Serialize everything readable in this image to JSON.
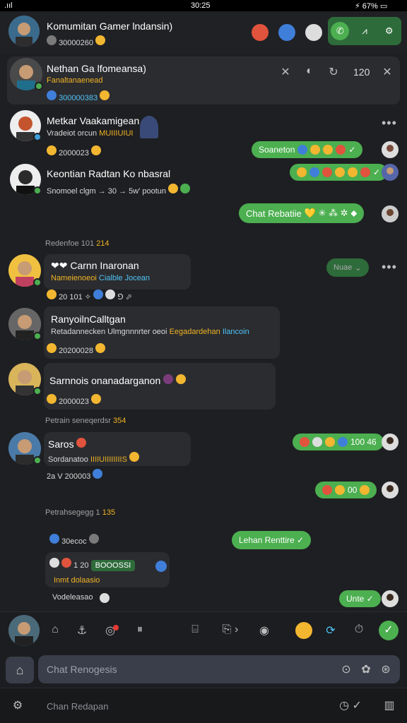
{
  "status_bar": {
    "carrier": ".ııl",
    "time": "30:25",
    "battery": "⚡ 67% ▭"
  },
  "header": {
    "title": "Komumitan Gamer lndansin)",
    "subtitle": "30000260",
    "actions": {
      "call": "✆",
      "pulse": "⩘",
      "settings": "⚙"
    }
  },
  "pinned": {
    "title": "Nethan Ga lfomeansa)",
    "subtitle": "Fanaltanaenead",
    "meta": "300000383",
    "count": "120"
  },
  "messages": [
    {
      "name": "Metkar Vaakamigean",
      "preview": "Vradeiot orcun",
      "tag": "MUIIIUIUI",
      "meta": "2000023"
    },
    {
      "name": "Keontian Radtan Ko nbasral",
      "preview": "Snomoel clgm → 30 → 5w' pootun"
    },
    {
      "name": "Carnn Inaronan",
      "preview": "Nameienoeoi",
      "tag": "Cialble Jocean",
      "meta": "20 101"
    },
    {
      "name": "RanyoilnCalltgan",
      "preview": "Retadannecken Ulmgnnnrter oeoi",
      "tag": "Eegadardehan",
      "tag2": "Ilancoin",
      "meta": "20200028"
    },
    {
      "name": "Sarnnois onanadarganon",
      "meta": "2000023"
    },
    {
      "name": "Saros",
      "preview": "Sordanatoo",
      "tag": "IIIIUIIIIIIIIS",
      "meta": "2a V 200003"
    }
  ],
  "outgoing": [
    {
      "label": "Soaneton"
    },
    {
      "label": ""
    },
    {
      "label": "Chat Rebatiie"
    },
    {
      "label": "Nuae"
    },
    {
      "label": "100 46"
    },
    {
      "label": "00"
    },
    {
      "label": "Lehan Renttire ✓"
    },
    {
      "label": "Unte ✓"
    }
  ],
  "separators": [
    {
      "label": "Redenfoe 101",
      "count": "214"
    },
    {
      "label": "Petrain seneqerdsr",
      "count": "354"
    },
    {
      "label": "Petrahsegegg 1",
      "count": "135"
    }
  ],
  "lower": {
    "item1": "30ecoc",
    "item2_count": "1 20",
    "item2_badge": "BOOOSSI",
    "item2_sub": "Inmt dolaasio",
    "item3": "Vodeleasao"
  },
  "input": {
    "placeholder": "Chat Renogesis"
  },
  "bottom": {
    "placeholder": "Chan Redapan"
  },
  "colors": {
    "accent": "#4caf50",
    "background": "#1e1f22",
    "card": "#2b2c30",
    "highlight": "#f0b323"
  }
}
